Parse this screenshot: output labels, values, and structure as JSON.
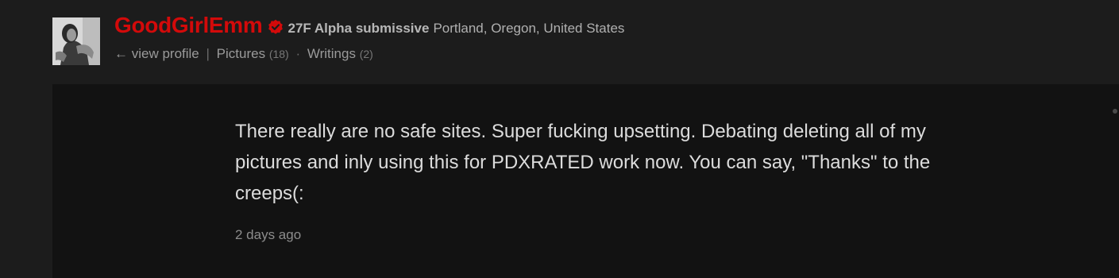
{
  "profile": {
    "username": "GoodGirlEmm",
    "verified_icon": "verified-badge-icon",
    "identity": "27F Alpha submissive",
    "location": "Portland, Oregon, United States",
    "avatar_icon": "profile-photo",
    "links": {
      "view_profile": "← view profile",
      "separator1": "|",
      "pictures_label": "Pictures",
      "pictures_count": "(18)",
      "separator2": "·",
      "writings_label": "Writings",
      "writings_count": "(2)"
    }
  },
  "post": {
    "text": "There really are no safe sites. Super fucking upsetting. Debating deleting all of my pictures and inly using this for PDXRATED work now. You can say, \"Thanks\" to the creeps(:",
    "timestamp": "2 days ago"
  },
  "colors": {
    "username": "#d30a0a",
    "background": "#1c1c1c",
    "post_background": "#121212"
  }
}
